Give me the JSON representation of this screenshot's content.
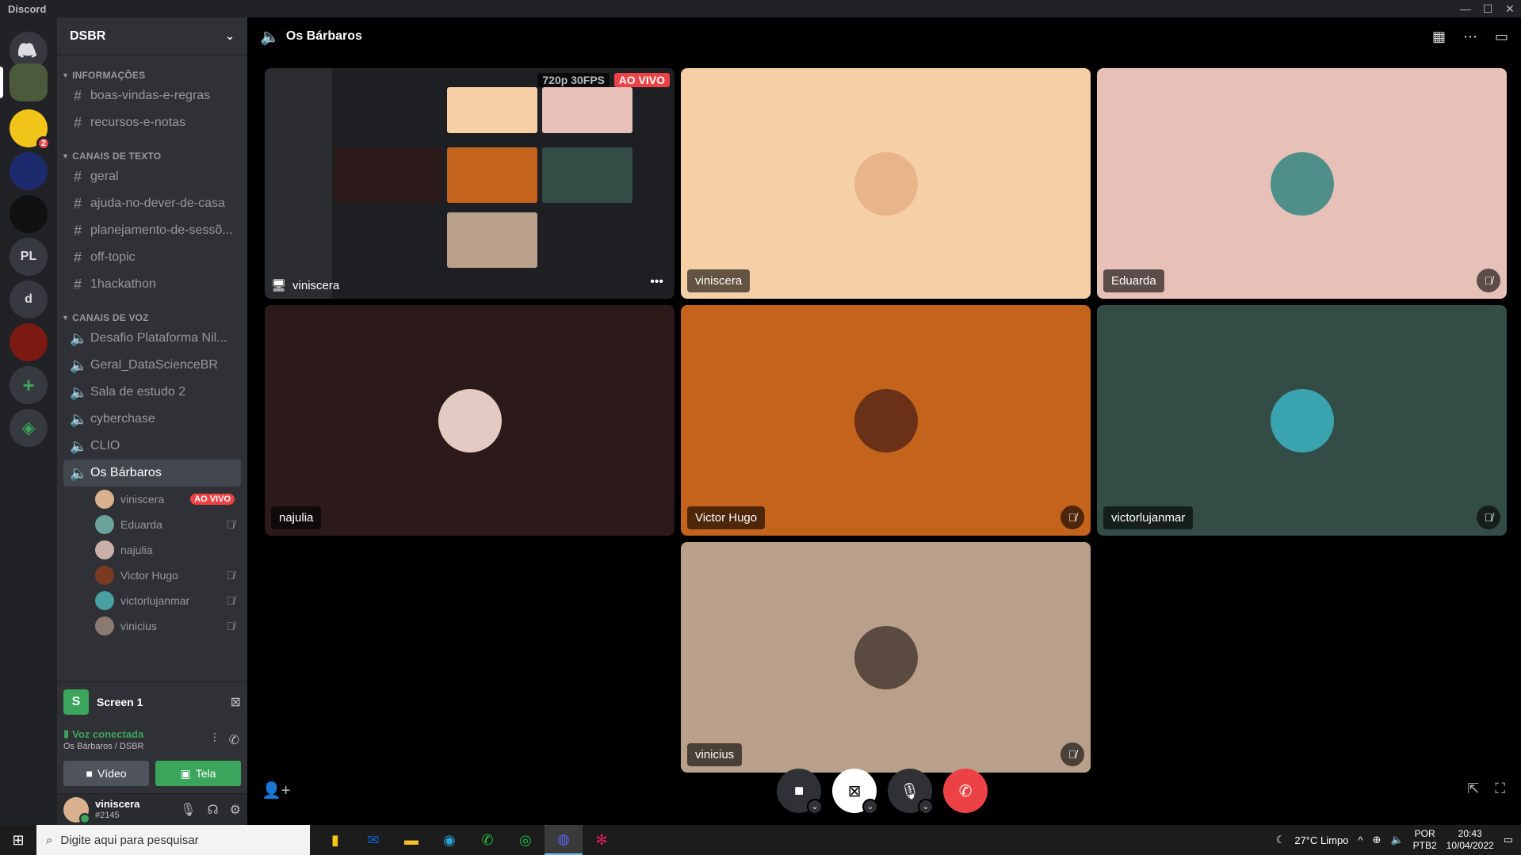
{
  "window": {
    "title": "Discord",
    "controls": [
      "—",
      "☐",
      "✕"
    ]
  },
  "servers": [
    {
      "label": "",
      "icon": "discord-home-icon",
      "color": "#36393f"
    },
    {
      "label": "",
      "icon": "server-dsbr",
      "color": "#4a5a3a"
    },
    {
      "label": "",
      "icon": "server-colorful",
      "color": "#f0c419",
      "badge": "2"
    },
    {
      "label": "",
      "icon": "server-wn",
      "color": "#1e2a6e"
    },
    {
      "label": "",
      "icon": "server-jrferraz",
      "color": "#111111"
    },
    {
      "label": "PL",
      "icon": "",
      "color": "#36393f"
    },
    {
      "label": "d",
      "icon": "",
      "color": "#36393f"
    },
    {
      "label": "",
      "icon": "server-ply",
      "color": "#7a1a12"
    }
  ],
  "guild": {
    "name": "DSBR"
  },
  "categories": {
    "info": "INFORMAÇÕES",
    "text": "CANAIS DE TEXTO",
    "voice": "CANAIS DE VOZ"
  },
  "info_channels": [
    "boas-vindas-e-regras",
    "recursos-e-notas"
  ],
  "text_channels": [
    "geral",
    "ajuda-no-dever-de-casa",
    "planejamento-de-sessõ...",
    "off-topic",
    "1hackathon"
  ],
  "voice_channels": [
    "Desafio Plataforma Nil...",
    "Geral_DataScienceBR",
    "Sala de estudo 2",
    "cyberchase",
    "CLIO",
    "Os Bárbaros"
  ],
  "voice_users": [
    {
      "name": "viniscera",
      "live": "AO VIVO",
      "muted": false,
      "color": "#d9b18f"
    },
    {
      "name": "Eduarda",
      "live": "",
      "muted": true,
      "color": "#6aa39a"
    },
    {
      "name": "najulia",
      "live": "",
      "muted": false,
      "color": "#c9b0a8"
    },
    {
      "name": "Victor Hugo",
      "live": "",
      "muted": true,
      "color": "#7a3a20"
    },
    {
      "name": "victorlujanmar",
      "live": "",
      "muted": true,
      "color": "#4aa0a0"
    },
    {
      "name": "vinicius",
      "live": "",
      "muted": true,
      "color": "#8a7a70"
    }
  ],
  "screen": {
    "initial": "S",
    "name": "Screen 1"
  },
  "voice_panel": {
    "status": "Voz conectada",
    "location": "Os Bárbaros / DSBR",
    "video_label": "Vídeo",
    "screen_label": "Tela"
  },
  "user": {
    "name": "viniscera",
    "tag": "#2145"
  },
  "main": {
    "channel": "Os Bárbaros"
  },
  "stream": {
    "quality": "720p 30FPS",
    "live": "AO VIVO",
    "user": "viniscera"
  },
  "tiles": [
    {
      "name": "viniscera",
      "bg": "#f5cfa6",
      "muted": false
    },
    {
      "name": "Eduarda",
      "bg": "#e7c1b8",
      "muted": true
    },
    {
      "name": "najulia",
      "bg": "#2c1a1a",
      "muted": false
    },
    {
      "name": "Victor Hugo",
      "bg": "#c4631c",
      "muted": true
    },
    {
      "name": "victorlujanmar",
      "bg": "#344c46",
      "muted": true
    },
    {
      "name": "vinicius",
      "bg": "#b9a08a",
      "muted": true
    }
  ],
  "taskbar": {
    "search_placeholder": "Digite aqui para pesquisar",
    "weather": "27°C  Limpo",
    "lang_1": "POR",
    "lang_2": "PTB2",
    "time": "20:43",
    "date": "10/04/2022"
  }
}
